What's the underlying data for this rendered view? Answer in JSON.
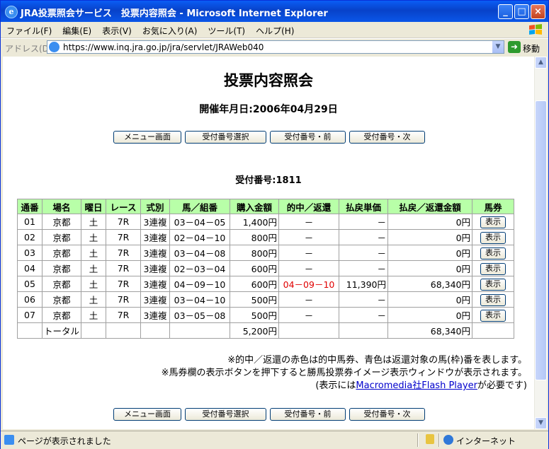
{
  "window": {
    "title": "JRA投票照会サービス　投票内容照会 - Microsoft Internet Explorer",
    "min_glyph": "_",
    "max_glyph": "□",
    "close_glyph": "×"
  },
  "menu": [
    "ファイル(F)",
    "編集(E)",
    "表示(V)",
    "お気に入り(A)",
    "ツール(T)",
    "ヘルプ(H)"
  ],
  "address": {
    "label": "アドレス(D)",
    "url": "https://www.inq.jra.go.jp/jra/servlet/JRAWeb040",
    "go_label": "移動"
  },
  "page": {
    "heading": "投票内容照会",
    "date_line": "開催年月日:2006年04月29日",
    "buttons": [
      "メニュー画面",
      "受付番号選択",
      "受付番号・前",
      "受付番号・次"
    ],
    "receipt_line": "受付番号:1811"
  },
  "table": {
    "headers": [
      "通番",
      "場名",
      "曜日",
      "レース",
      "式別",
      "馬／組番",
      "購入金額",
      "的中／返還",
      "払戻単価",
      "払戻／返還金額",
      "馬券"
    ],
    "rows": [
      [
        "01",
        "京都",
        "土",
        "7R",
        "3連複",
        "03－04－05",
        "1,400円",
        "－",
        "－",
        "0円",
        "表示"
      ],
      [
        "02",
        "京都",
        "土",
        "7R",
        "3連複",
        "02－04－10",
        "800円",
        "－",
        "－",
        "0円",
        "表示"
      ],
      [
        "03",
        "京都",
        "土",
        "7R",
        "3連複",
        "03－04－08",
        "800円",
        "－",
        "－",
        "0円",
        "表示"
      ],
      [
        "04",
        "京都",
        "土",
        "7R",
        "3連複",
        "02－03－04",
        "600円",
        "－",
        "－",
        "0円",
        "表示"
      ],
      [
        "05",
        "京都",
        "土",
        "7R",
        "3連複",
        "04－09－10",
        "600円",
        "04－09－10",
        "11,390円",
        "68,340円",
        "表示"
      ],
      [
        "06",
        "京都",
        "土",
        "7R",
        "3連複",
        "03－04－10",
        "500円",
        "－",
        "－",
        "0円",
        "表示"
      ],
      [
        "07",
        "京都",
        "土",
        "7R",
        "3連複",
        "03－05－08",
        "500円",
        "－",
        "－",
        "0円",
        "表示"
      ]
    ],
    "total_label": "トータル",
    "total_purchase": "5,200円",
    "total_payout": "68,340円",
    "hit_color": "#e00000",
    "header_color": "#b8ffa8"
  },
  "notes": {
    "line1": "※的中／返還の赤色は的中馬券、青色は返還対象の馬(枠)番を表します。",
    "line2": "※馬券欄の表示ボタンを押下すると勝馬投票券イメージ表示ウィンドウが表示されます。",
    "line3_pre": "(表示には",
    "line3_link": "Macromedia社Flash Player",
    "line3_post": "が必要です)"
  },
  "status": {
    "text": "ページが表示されました",
    "zone": "インターネット"
  }
}
